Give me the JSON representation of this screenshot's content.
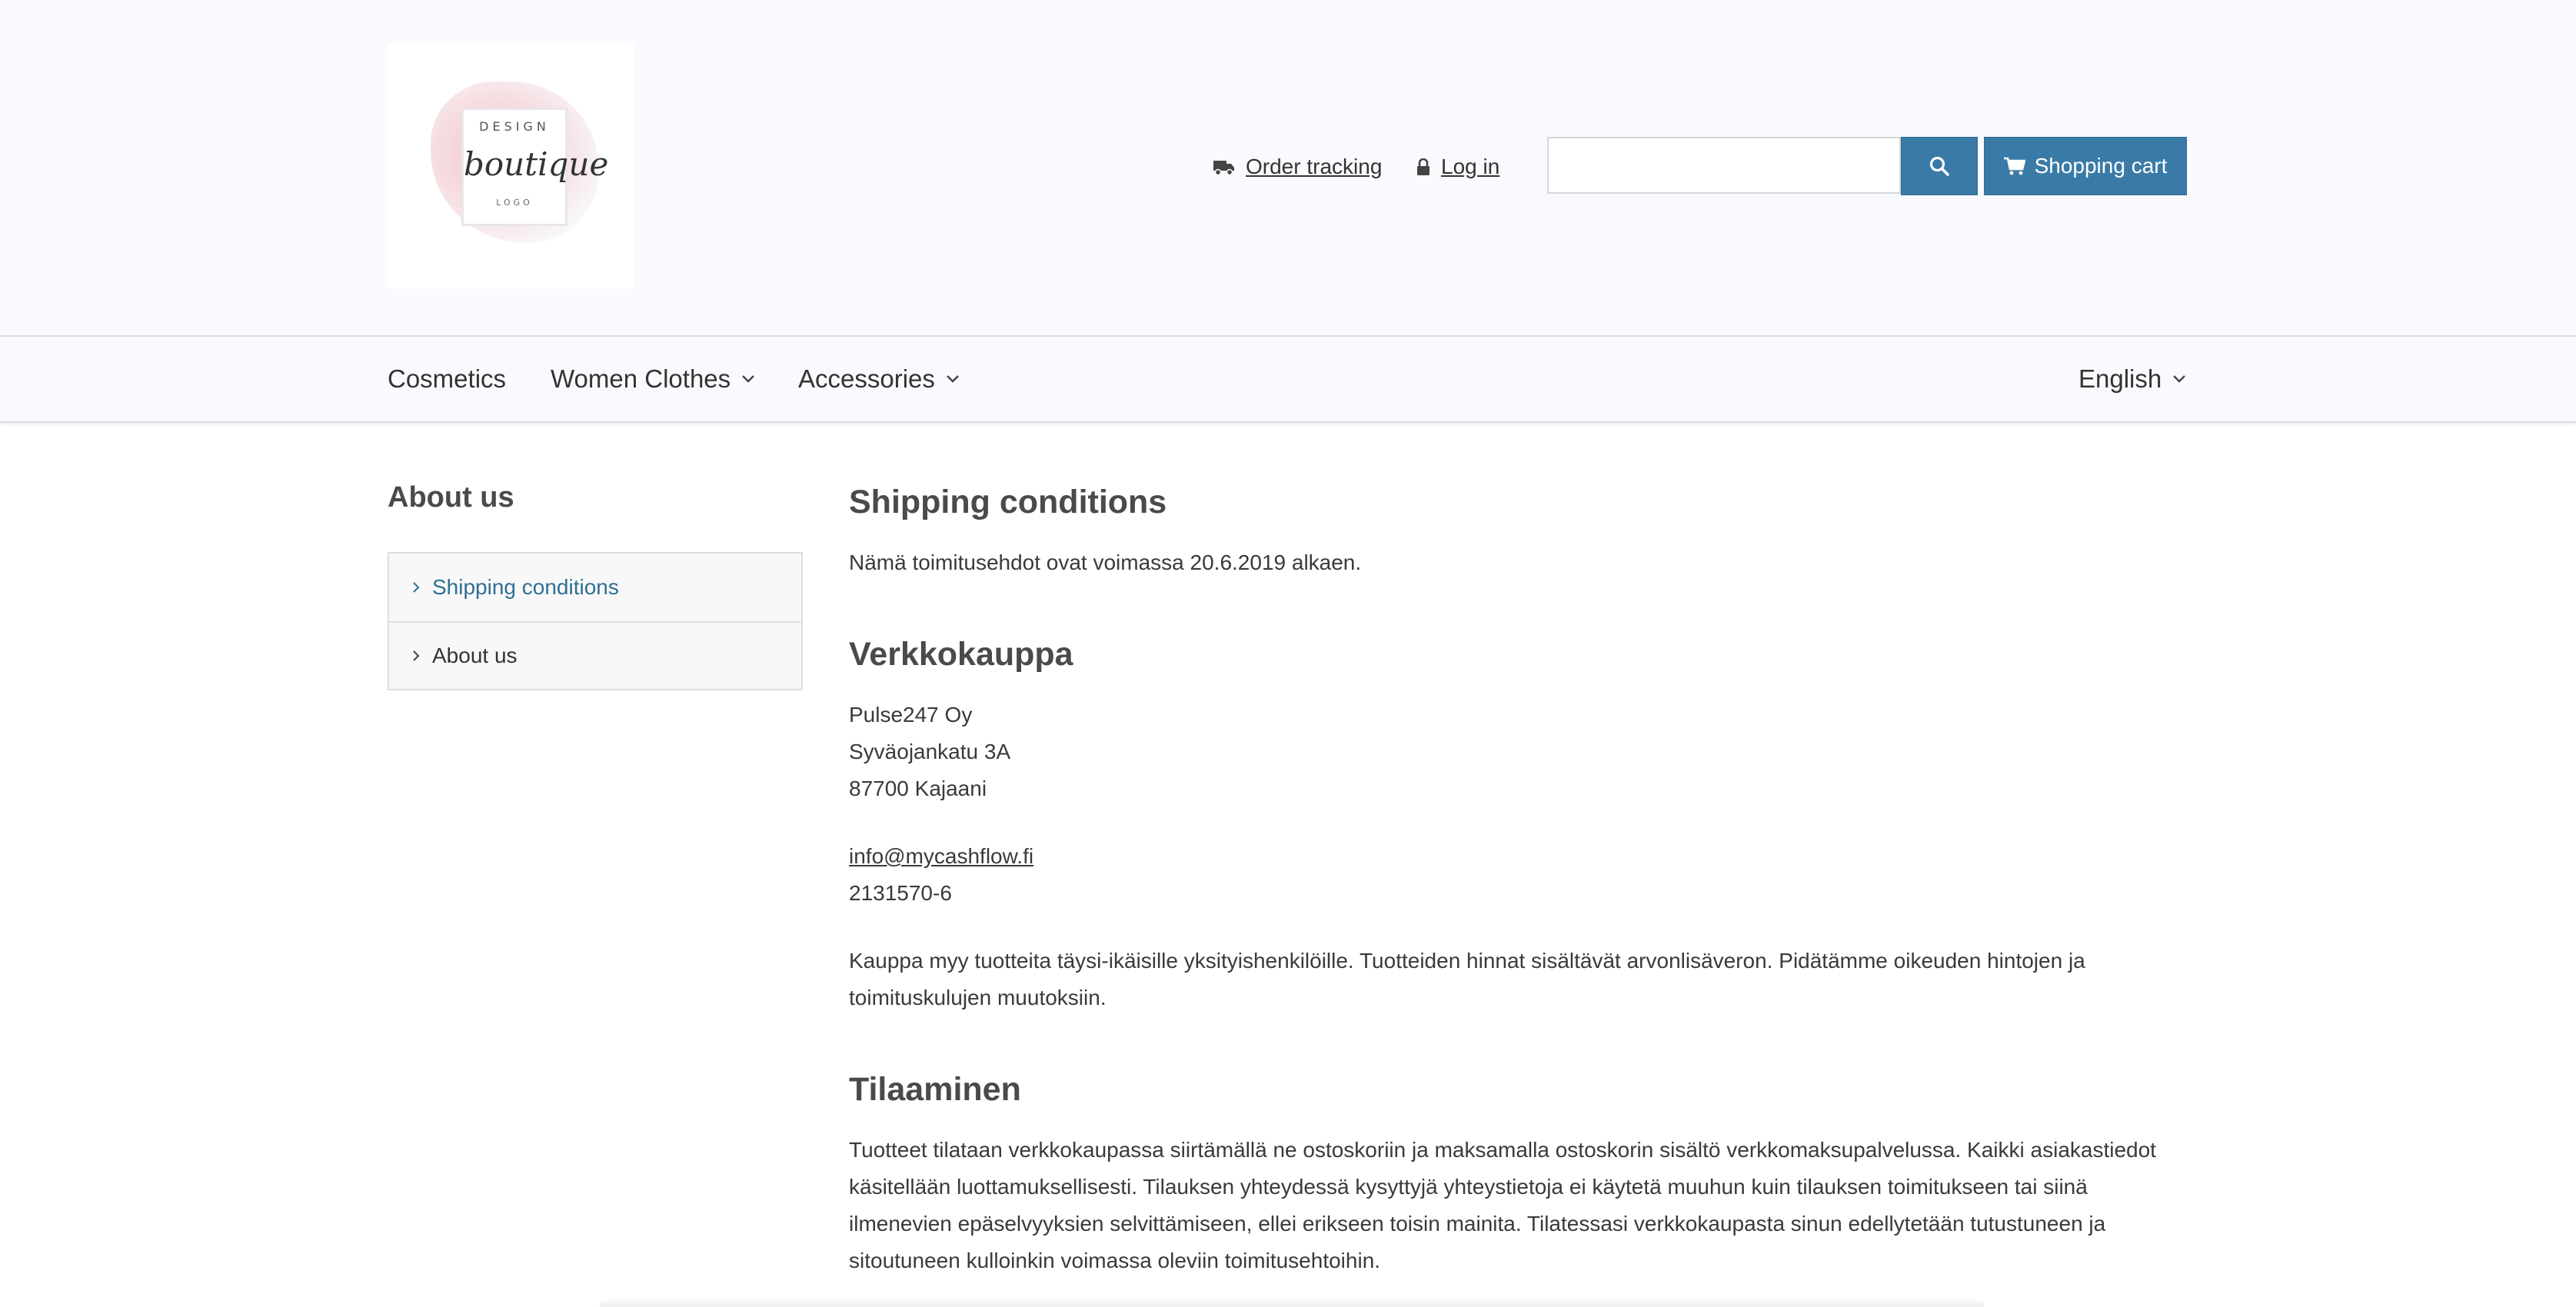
{
  "header": {
    "logo": {
      "line1": "DESIGN",
      "line2": "boutique",
      "line3": "LOGO"
    },
    "order_tracking": "Order tracking",
    "login": "Log in",
    "search_placeholder": "",
    "cart_label": "Shopping cart",
    "accent_color": "#3a7aa6"
  },
  "nav": {
    "items": [
      {
        "label": "Cosmetics",
        "has_dropdown": false
      },
      {
        "label": "Women Clothes",
        "has_dropdown": true
      },
      {
        "label": "Accessories",
        "has_dropdown": true
      }
    ],
    "language": "English"
  },
  "sidebar": {
    "heading": "About us",
    "items": [
      {
        "label": "Shipping conditions",
        "active": true
      },
      {
        "label": "About us",
        "active": false
      }
    ]
  },
  "content": {
    "title": "Shipping conditions",
    "intro": "Nämä toimitusehdot ovat voimassa 20.6.2019 alkaen.",
    "section1": {
      "heading": "Verkkokauppa",
      "company": "Pulse247 Oy",
      "street": "Syväojankatu 3A",
      "city": "87700 Kajaani",
      "email": "info@mycashflow.fi",
      "business_id": "2131570-6",
      "text": "Kauppa myy tuotteita täysi-ikäisille yksityishenkilöille. Tuotteiden hinnat sisältävät arvonlisäveron. Pidätämme oikeuden hintojen ja toimituskulujen muutoksiin."
    },
    "section2": {
      "heading": "Tilaaminen",
      "text": "Tuotteet tilataan verkkokaupassa siirtämällä ne ostoskoriin ja maksamalla ostoskorin sisältö verkkomaksupalvelussa. Kaikki asiakastiedot käsitellään luottamuksellisesti. Tilauksen yhteydessä kysyttyjä yhteystietoja ei käytetä muuhun kuin tilauksen toimitukseen tai siinä ilmenevien epäselvyyksien selvittämiseen, ellei erikseen toisin mainita. Tilatessasi verkkokaupasta sinun edellytetään tutustuneen ja sitoutuneen kulloinkin voimassa oleviin toimitusehtoihin."
    }
  }
}
